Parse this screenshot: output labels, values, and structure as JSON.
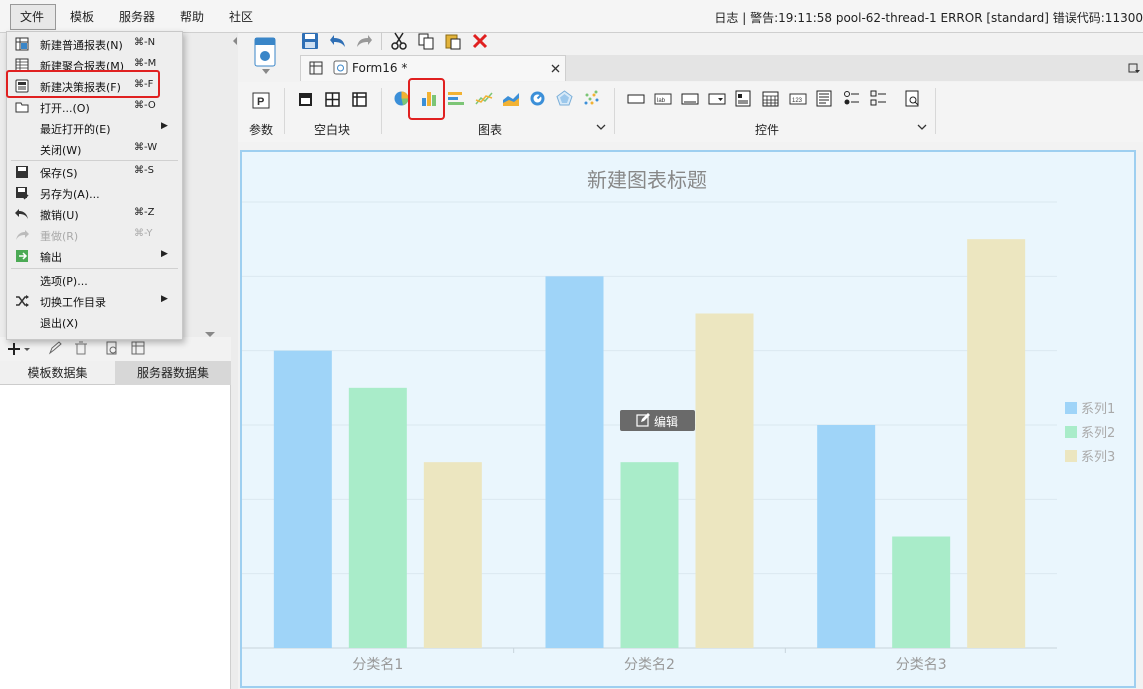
{
  "menubar": {
    "items": [
      "文件",
      "模板",
      "服务器",
      "帮助",
      "社区"
    ],
    "log_text": "日志 | 警告:19:11:58 pool-62-thread-1 ERROR [standard] 错误代码:11300"
  },
  "file_menu": {
    "items": [
      {
        "label": "新建普通报表(N)",
        "shortcut": "⌘-N",
        "icon": "report-icon"
      },
      {
        "label": "新建聚合报表(M)",
        "shortcut": "⌘-M",
        "icon": "aggregate-report-icon"
      },
      {
        "label": "新建决策报表(F)",
        "shortcut": "⌘-F",
        "icon": "decision-report-icon"
      },
      {
        "label": "打开...(O)",
        "shortcut": "⌘-O",
        "icon": "folder-icon"
      },
      {
        "label": "最近打开的(E)",
        "shortcut": "",
        "icon": "",
        "submenu": true
      },
      {
        "label": "关闭(W)",
        "shortcut": "⌘-W",
        "icon": ""
      },
      {
        "label": "保存(S)",
        "shortcut": "⌘-S",
        "icon": "save-icon"
      },
      {
        "label": "另存为(A)...",
        "shortcut": "",
        "icon": "save-as-icon"
      },
      {
        "label": "撤销(U)",
        "shortcut": "⌘-Z",
        "icon": "undo-icon"
      },
      {
        "label": "重做(R)",
        "shortcut": "⌘-Y",
        "icon": "redo-icon",
        "disabled": true
      },
      {
        "label": "输出",
        "shortcut": "",
        "icon": "export-icon",
        "submenu": true
      },
      {
        "label": "选项(P)...",
        "shortcut": "",
        "icon": ""
      },
      {
        "label": "切换工作目录",
        "shortcut": "",
        "icon": "shuffle-icon",
        "submenu": true
      },
      {
        "label": "退出(X)",
        "shortcut": "",
        "icon": ""
      }
    ]
  },
  "left_panel": {
    "tabs": [
      "模板数据集",
      "服务器数据集"
    ]
  },
  "editor": {
    "tab_title": "Form16 *",
    "ribbon_groups": [
      "参数",
      "空白块",
      "图表",
      "控件"
    ]
  },
  "colors": {
    "series1": "#9fd4f8",
    "series2": "#a9ecc9",
    "series3": "#ece6c0",
    "highlight": "#e02020"
  },
  "chart_data": {
    "type": "bar",
    "title": "新建图表标题",
    "categories": [
      "分类名1",
      "分类名2",
      "分类名3"
    ],
    "series": [
      {
        "name": "系列1",
        "values": [
          4,
          5,
          3
        ]
      },
      {
        "name": "系列2",
        "values": [
          3.5,
          2.5,
          1.5
        ]
      },
      {
        "name": "系列3",
        "values": [
          2.5,
          4.5,
          5.5
        ]
      }
    ],
    "ylim": [
      0,
      6
    ],
    "grid": true,
    "legend": "right"
  },
  "edit_button": "编辑"
}
